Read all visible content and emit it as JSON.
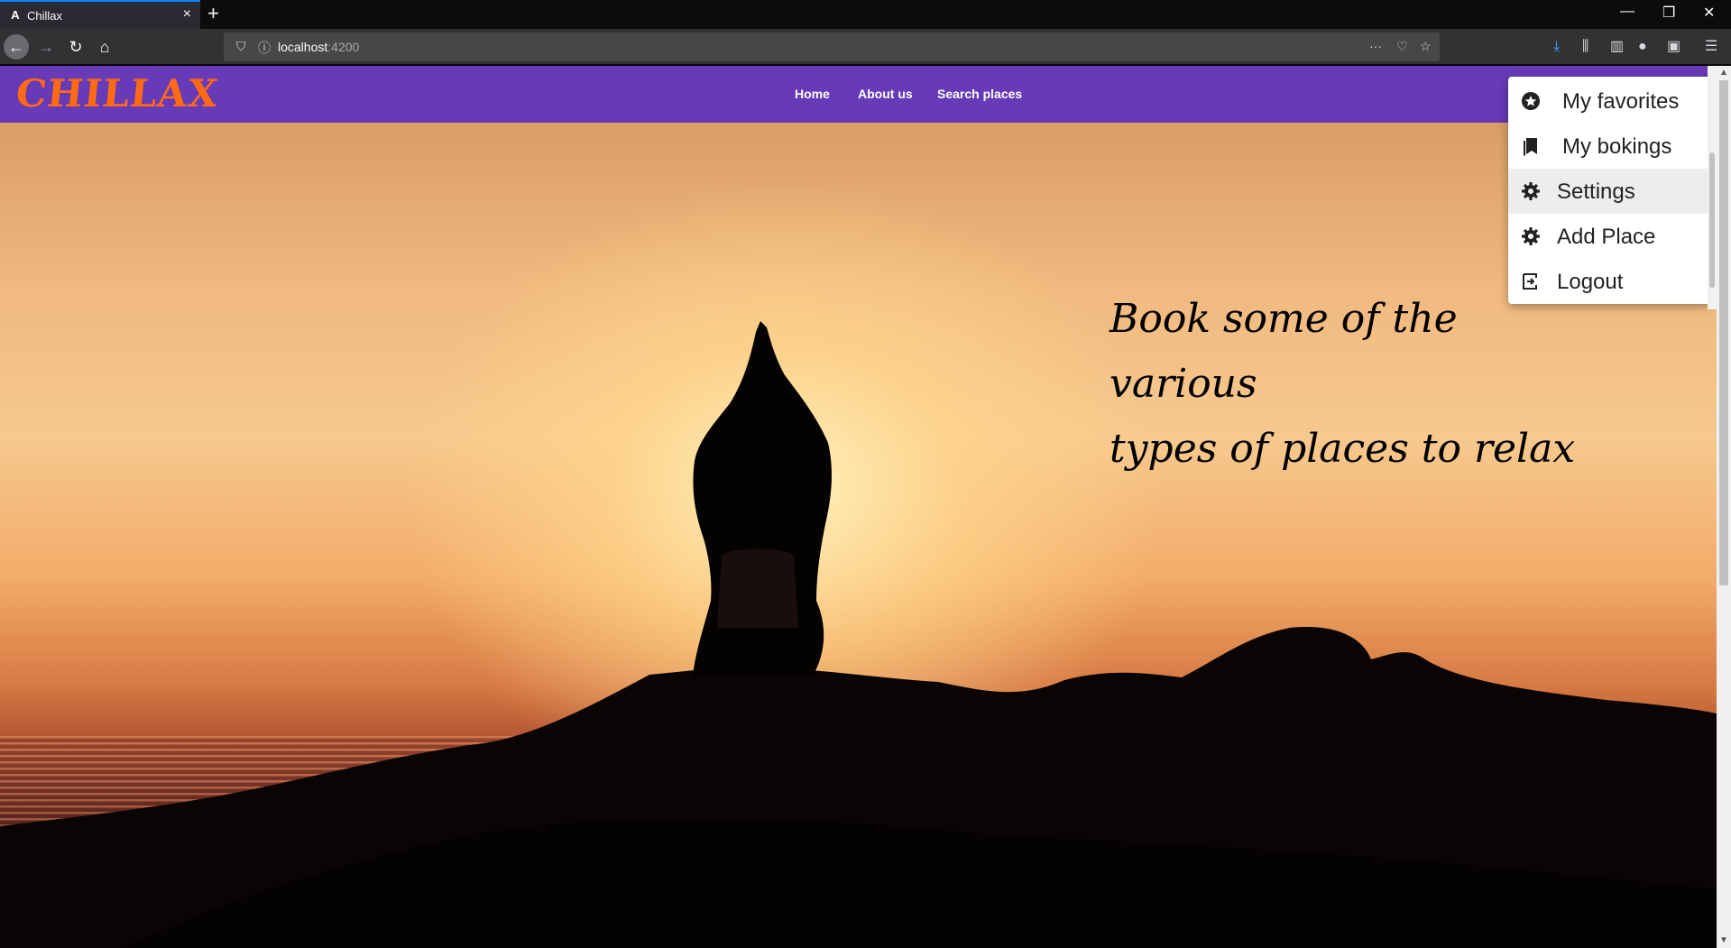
{
  "browser": {
    "tab_title": "Chillax",
    "tab_favicon": "A",
    "new_tab": "+",
    "url_host": "localhost",
    "url_port": ":4200",
    "window_controls": {
      "minimize": "—",
      "restore": "❐",
      "close": "✕"
    }
  },
  "site": {
    "logo": "CHILLAX",
    "nav": [
      "Home",
      "About us",
      "Search places"
    ],
    "headline_line1": "Book some of the various",
    "headline_line2": "types of places to relax"
  },
  "dropdown": {
    "items": [
      {
        "label": "My favorites",
        "icon": "star-circle-icon"
      },
      {
        "label": "My bokings",
        "icon": "bookmarks-icon"
      },
      {
        "label": "Settings",
        "icon": "gear-icon"
      },
      {
        "label": "Add Place",
        "icon": "gear-icon"
      },
      {
        "label": "Logout",
        "icon": "logout-icon"
      }
    ]
  },
  "colors": {
    "brand_bar": "#673ab7",
    "logo": "#ff6a13",
    "accent": "#0a84ff"
  }
}
